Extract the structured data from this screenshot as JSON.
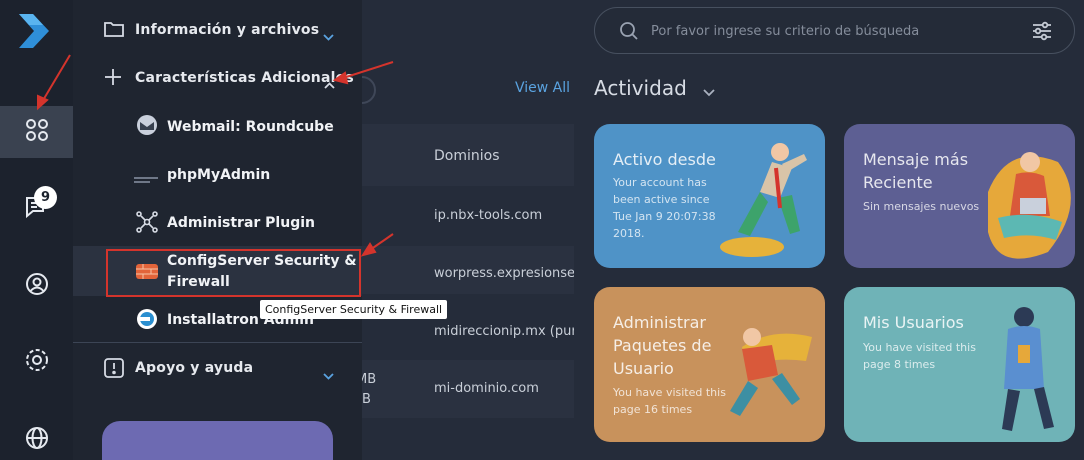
{
  "rail": {
    "notification_count": "9"
  },
  "menu": {
    "info_files": "Información y archivos",
    "additional_features": "Características Adicionales",
    "items": [
      {
        "label": "Webmail: Roundcube"
      },
      {
        "label": "phpMyAdmin"
      },
      {
        "label": "Administrar Plugin"
      },
      {
        "label": "ConfigServer Security &"
      },
      {
        "label": "Firewall"
      },
      {
        "label": "Installatron Admin"
      }
    ],
    "support": "Apoyo y ayuda",
    "tooltip": "ConfigServer Security & Firewall"
  },
  "domains": {
    "view_all": "View All",
    "header": "Dominios",
    "header_left": "/",
    "rows": [
      {
        "domain": "ip.nbx-tools.com",
        "left": ""
      },
      {
        "domain": "worpress.expresionser",
        "left": ""
      },
      {
        "domain": "midireccionip.mx (pur",
        "left": ""
      },
      {
        "domain": "mi-dominio.com",
        "left": "MB"
      },
      {
        "domain": "",
        "left": "B"
      }
    ]
  },
  "search": {
    "placeholder": "Por favor ingrese su criterio de búsqueda"
  },
  "activity": {
    "title": "Actividad",
    "cards": [
      {
        "title": "Activo desde",
        "sub": "Your account has been active since Tue Jan 9 20:07:38 2018.",
        "color": "#4f93c7"
      },
      {
        "title_l1": "Mensaje más",
        "title_l2": "Reciente",
        "sub": "Sin mensajes nuevos",
        "color": "#5d5f93"
      },
      {
        "title_l1": "Administrar",
        "title_l2": "Paquetes de",
        "title_l3": "Usuario",
        "sub_l1": "You have visited this",
        "sub_l2": "page 16 times",
        "color": "#c8925c"
      },
      {
        "title": "Mis Usuarios",
        "sub_l1": "You have visited this",
        "sub_l2": "page 8 times",
        "color": "#6fb3b7"
      }
    ]
  },
  "colors": {
    "accent": "#5aa3e0",
    "annotation_red": "#d4342c"
  }
}
